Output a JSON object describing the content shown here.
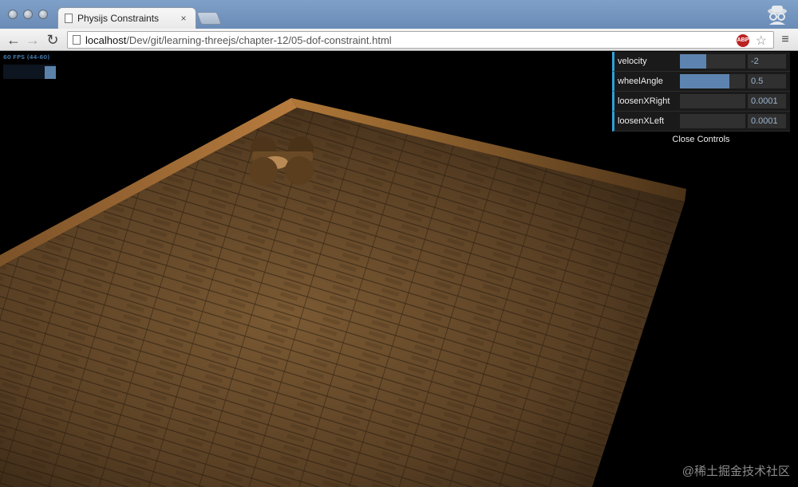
{
  "browser": {
    "tab_title": "Physijs Constraints",
    "tab_close": "×",
    "url_host": "localhost",
    "url_path": "/Dev/git/learning-threejs/chapter-12/05-dof-constraint.html",
    "abp_label": "ABP",
    "back_icon": "arrow-left",
    "forward_icon": "arrow-right",
    "reload_icon": "reload",
    "menu_icon": "hamburger",
    "star_icon": "star"
  },
  "stats": {
    "text": "60 FPS (44-60)"
  },
  "gui": {
    "controls": [
      {
        "label": "velocity",
        "value": "-2",
        "fill": 0.4
      },
      {
        "label": "wheelAngle",
        "value": "0.5",
        "fill": 0.75
      },
      {
        "label": "loosenXRight",
        "value": "0.0001",
        "fill": 0
      },
      {
        "label": "loosenXLeft",
        "value": "0.0001",
        "fill": 0
      }
    ],
    "close_label": "Close Controls"
  },
  "watermark": "@稀土掘金技术社区",
  "colors": {
    "accent": "#2fa1d6",
    "slider_fill": "#5d84b0",
    "floor": "#5a4024",
    "wall": "#a46e35"
  }
}
